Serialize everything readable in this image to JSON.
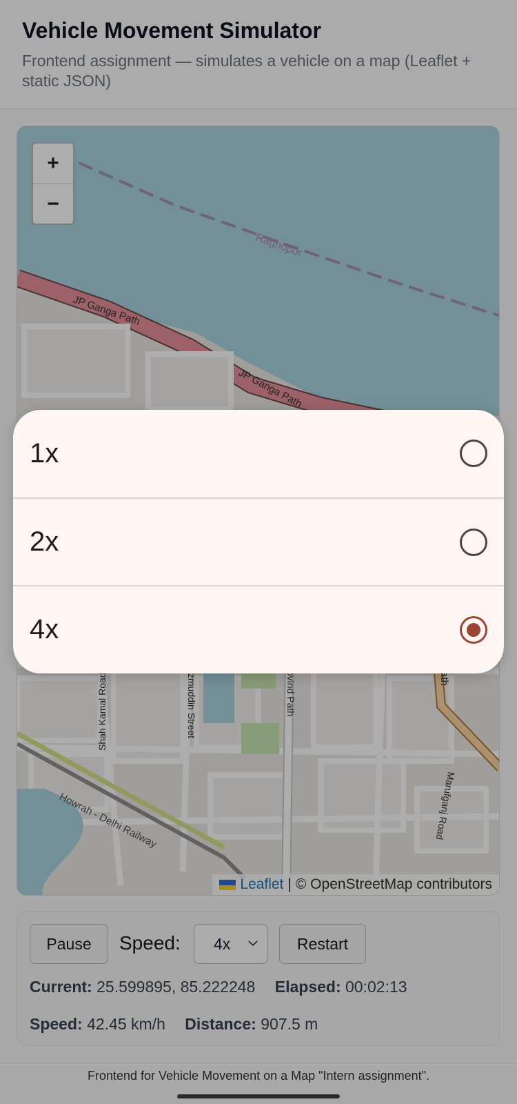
{
  "header": {
    "title": "Vehicle Movement Simulator",
    "subtitle": "Frontend assignment — simulates a vehicle on a map (Leaflet + static JSON)"
  },
  "map": {
    "zoom_in": "+",
    "zoom_out": "−",
    "labels": {
      "river": "Raghopur",
      "road1": "JP Ganga Path",
      "road2": "JP Ganga Path",
      "street1": "Shah Kamal Road",
      "street2": "Nazmuddin Street",
      "street3": "Govind Path",
      "street4": "Marufganj Road",
      "railway": "Howrah - Delhi Railway",
      "path_top_right": "Path"
    },
    "attribution": {
      "leaflet": "Leaflet",
      "separator": "|",
      "osm": "© OpenStreetMap contributors"
    }
  },
  "controls": {
    "pause_label": "Pause",
    "speed_label": "Speed:",
    "speed_value": "4x",
    "restart_label": "Restart",
    "current_label": "Current:",
    "current_value": "25.599895, 85.222248",
    "elapsed_label": "Elapsed:",
    "elapsed_value": "00:02:13",
    "speed_stat_label": "Speed:",
    "speed_stat_value": "42.45 km/h",
    "distance_label": "Distance:",
    "distance_value": "907.5 m"
  },
  "footer": {
    "text": "Frontend for Vehicle Movement on a Map \"Intern assignment\"."
  },
  "speed_picker": {
    "options": [
      {
        "label": "1x",
        "selected": false
      },
      {
        "label": "2x",
        "selected": false
      },
      {
        "label": "4x",
        "selected": true
      }
    ],
    "accent_color": "#9c4535"
  }
}
